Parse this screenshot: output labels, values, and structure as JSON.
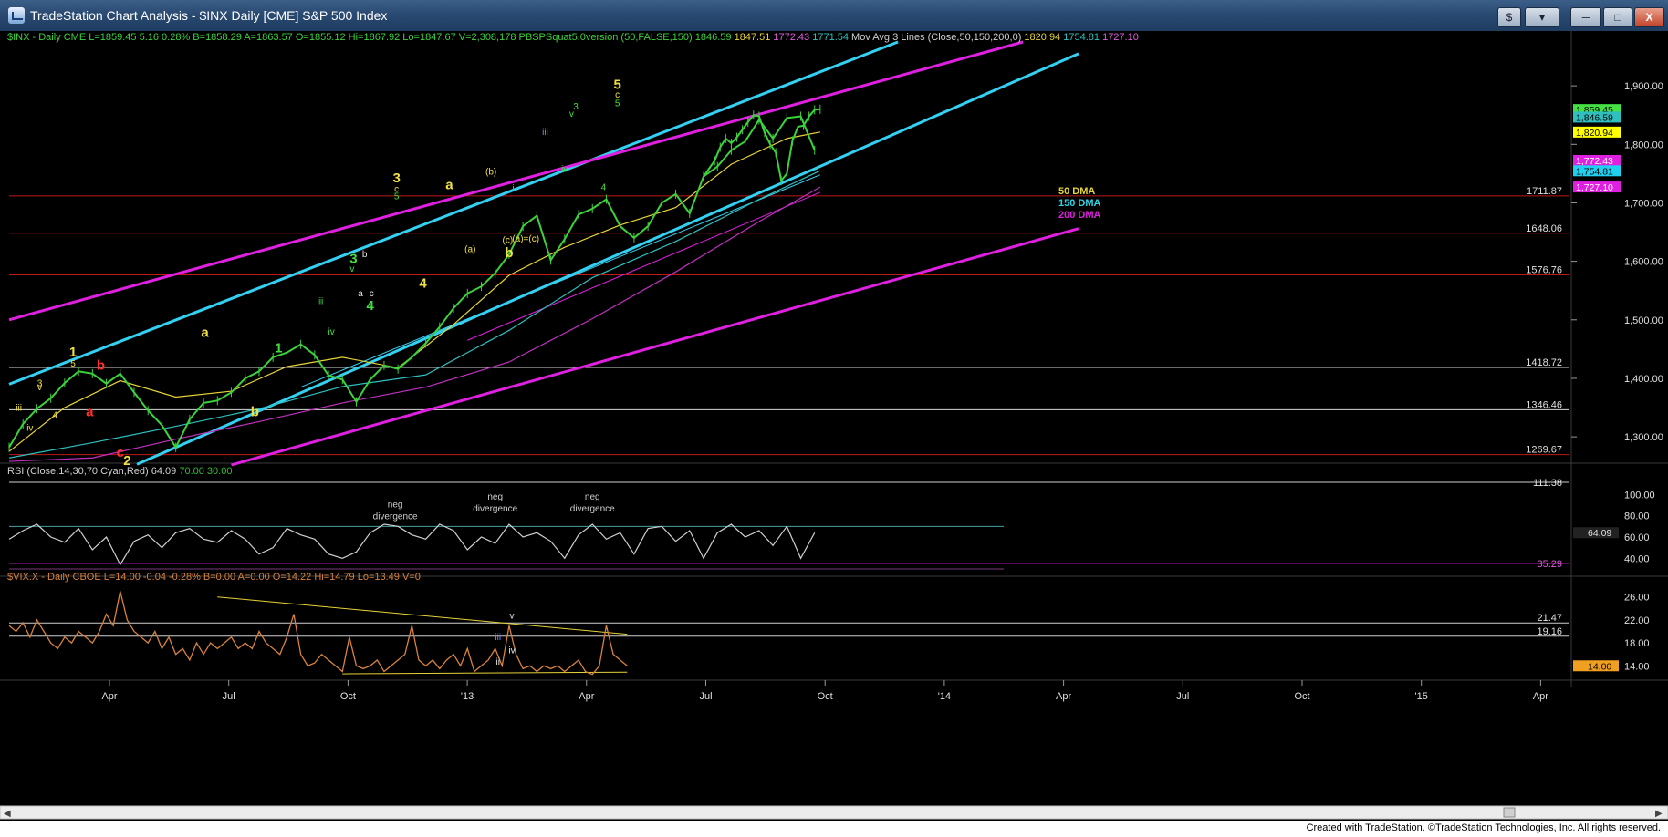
{
  "window": {
    "title": "TradeStation Chart Analysis - $INX Daily [CME] S&P 500 Index",
    "buttons": {
      "dollar": "$",
      "toggle": "",
      "minimize": "",
      "maximize": "",
      "close": "X"
    }
  },
  "footer": {
    "credit": "Created with TradeStation. ©TradeStation Technologies, Inc. All rights reserved."
  },
  "colors": {
    "background": "#000000",
    "price": "#3cd23c",
    "vix": "#d8823c",
    "rsi": "#cfcfcf",
    "channel_cyan": "#33d0f2",
    "channel_magenta": "#e020e0",
    "sma50": "#e6d238",
    "sma150": "#2fbfbf",
    "sma200": "#c030c0",
    "hline_red": "#c01818",
    "hline_white": "#d8d8d8"
  },
  "price_header": [
    {
      "t": "$INX - Daily  CME  L=1859.45  5.16  0.28%  B=1858.29  A=1863.57  O=1855.12  Hi=1867.92  Lo=1847.67  V=2,308,178  PBSPSquat5.0version (50,FALSE,150)",
      "c": "#3cd23c"
    },
    {
      "t": "1846.59",
      "c": "#3cd23c"
    },
    {
      "t": "1847.51",
      "c": "#e6d238"
    },
    {
      "t": "1772.43",
      "c": "#e05ce0"
    },
    {
      "t": "1771.54",
      "c": "#2fbfbf"
    },
    {
      "t": "Mov Avg 3 Lines (Close,50,150,200,0)",
      "c": "#d0d0d0"
    },
    {
      "t": "1820.94",
      "c": "#e6d238"
    },
    {
      "t": "1754.81",
      "c": "#2fbfbf"
    },
    {
      "t": "1727.10",
      "c": "#e05ce0"
    }
  ],
  "rsi_header": [
    {
      "t": "RSI (Close,14,30,70,Cyan,Red)",
      "c": "#d0d0d0"
    },
    {
      "t": "64.09",
      "c": "#d0d0d0"
    },
    {
      "t": "70.00",
      "c": "#2fbf2f"
    },
    {
      "t": "30.00",
      "c": "#2fbf2f"
    }
  ],
  "vix_header": [
    {
      "t": "$VIX.X - Daily  CBOE  L=14.00  -0.04  -0.28%  B=0.00  A=0.00  O=14.22  Hi=14.79  Lo=13.49  V=0",
      "c": "#d8823c"
    }
  ],
  "ma_legend": [
    {
      "t": "50 DMA",
      "c": "#e6d238"
    },
    {
      "t": "150 DMA",
      "c": "#2fd6e8"
    },
    {
      "t": "200 DMA",
      "c": "#e020e0"
    }
  ],
  "chart_data": [
    {
      "type": "line",
      "title": "$INX Daily [CME] S&P 500 Index",
      "x_labels": [
        "Apr",
        "Jul",
        "Oct",
        "'13",
        "Apr",
        "Jul",
        "Oct",
        "'14",
        "Apr",
        "Jul",
        "Oct",
        "'15",
        "Apr"
      ],
      "y_ticks": [
        1300,
        1400,
        1500,
        1600,
        1700,
        1800,
        1900
      ],
      "ylim": [
        1255,
        1975
      ],
      "grid": false,
      "series": [
        {
          "x": [
            0,
            10,
            20,
            30,
            40,
            50,
            60,
            70,
            80,
            90,
            100,
            110,
            120,
            130,
            140,
            150,
            160,
            170,
            180,
            190,
            200,
            210,
            220,
            230,
            240,
            250,
            260,
            270,
            280,
            290,
            300,
            310,
            320,
            330,
            340,
            350,
            360,
            370,
            380,
            390,
            400,
            410,
            420,
            430,
            440,
            450,
            460,
            470,
            480,
            490,
            500,
            510,
            520,
            530,
            540,
            550,
            560,
            570,
            580
          ],
          "values": [
            1282,
            1322,
            1348,
            1366,
            1392,
            1412,
            1408,
            1391,
            1408,
            1376,
            1345,
            1320,
            1282,
            1330,
            1358,
            1362,
            1376,
            1400,
            1412,
            1436,
            1444,
            1458,
            1440,
            1405,
            1398,
            1360,
            1398,
            1422,
            1416,
            1436,
            1460,
            1488,
            1520,
            1545,
            1557,
            1580,
            1612,
            1660,
            1678,
            1602,
            1638,
            1680,
            1690,
            1706,
            1660,
            1640,
            1660,
            1700,
            1715,
            1682,
            1745,
            1762,
            1790,
            1805,
            1842,
            1810,
            1845,
            1848,
            1790
          ]
        },
        {
          "x": [
            500,
            508,
            512,
            516,
            520,
            524,
            528,
            532,
            536,
            540,
            544,
            548,
            552,
            556,
            560,
            564,
            568,
            572,
            576,
            580,
            584
          ],
          "values": [
            1745,
            1772,
            1795,
            1810,
            1802,
            1812,
            1825,
            1838,
            1850,
            1848,
            1820,
            1800,
            1786,
            1738,
            1750,
            1806,
            1830,
            1832,
            1848,
            1859,
            1860
          ]
        }
      ],
      "moving_averages": {
        "sma50": {
          "x": [
            0,
            40,
            80,
            120,
            160,
            200,
            240,
            280,
            320,
            360,
            400,
            440,
            480,
            520,
            560,
            584
          ],
          "values": [
            1275,
            1350,
            1396,
            1368,
            1378,
            1420,
            1436,
            1418,
            1492,
            1576,
            1624,
            1662,
            1692,
            1766,
            1810,
            1821
          ]
        },
        "sma150": {
          "x": [
            0,
            60,
            120,
            180,
            240,
            300,
            360,
            420,
            480,
            540,
            584
          ],
          "values": [
            1264,
            1290,
            1318,
            1348,
            1386,
            1406,
            1482,
            1572,
            1634,
            1706,
            1755
          ]
        },
        "sma200": {
          "x": [
            0,
            60,
            120,
            180,
            240,
            300,
            360,
            420,
            480,
            540,
            584
          ],
          "values": [
            1258,
            1264,
            1296,
            1326,
            1358,
            1385,
            1428,
            1502,
            1582,
            1668,
            1727
          ]
        }
      },
      "horizontal_levels": [
        {
          "label": "1711.87",
          "value": 1711.87,
          "color": "red"
        },
        {
          "label": "1648.06",
          "value": 1648.06,
          "color": "red"
        },
        {
          "label": "1576.76",
          "value": 1576.76,
          "color": "red"
        },
        {
          "label": "1418.72",
          "value": 1418.72,
          "color": "white"
        },
        {
          "label": "1346.46",
          "value": 1346.46,
          "color": "white"
        },
        {
          "label": "1269.67",
          "value": 1269.67,
          "color": "red"
        }
      ],
      "price_tags": [
        {
          "label": "1,859.45",
          "value": 1859.45,
          "bg": "#44e044",
          "fg": "#000000"
        },
        {
          "label": "1,846.59",
          "value": 1846.59,
          "bg": "#2fbfbf",
          "fg": "#000000"
        },
        {
          "label": "1,820.94",
          "value": 1820.94,
          "bg": "#ffff00",
          "fg": "#000000"
        },
        {
          "label": "1,772.43",
          "value": 1772.43,
          "bg": "#e020e0",
          "fg": "#ffffff"
        },
        {
          "label": "1,754.81",
          "value": 1754.81,
          "bg": "#20d0f0",
          "fg": "#000000"
        },
        {
          "label": "1,727.10",
          "value": 1727.1,
          "bg": "#e020e0",
          "fg": "#ffffff"
        }
      ],
      "trend_channels": [
        {
          "name": "cyan-upper",
          "color": "cyan",
          "x1": 0,
          "y1": 1390,
          "x2": 640,
          "y2": 1975
        },
        {
          "name": "cyan-lower",
          "color": "cyan",
          "x1": 92,
          "y1": 1253,
          "x2": 770,
          "y2": 1955
        },
        {
          "name": "magenta-upper",
          "color": "magenta",
          "x1": 0,
          "y1": 1500,
          "x2": 730,
          "y2": 1975
        },
        {
          "name": "magenta-lower",
          "color": "magenta",
          "x1": 160,
          "y1": 1252,
          "x2": 770,
          "y2": 1656
        },
        {
          "name": "cyan-minor",
          "color": "cyan",
          "x1": 210,
          "y1": 1385,
          "x2": 584,
          "y2": 1748
        },
        {
          "name": "magenta-minor",
          "color": "magenta",
          "x1": 330,
          "y1": 1465,
          "x2": 584,
          "y2": 1718
        }
      ],
      "wave_labels": [
        {
          "t": "iii",
          "x": 7,
          "v": 1345,
          "c": "yellow"
        },
        {
          "t": "iv",
          "x": 15,
          "v": 1310,
          "c": "yellow"
        },
        {
          "t": "v",
          "x": 22,
          "v": 1380,
          "c": "yellow"
        },
        {
          "t": "3",
          "x": 22,
          "v": 1387,
          "c": "yellow"
        },
        {
          "t": "4",
          "x": 33,
          "v": 1332,
          "c": "yellow"
        },
        {
          "t": "1",
          "x": 46,
          "v": 1437,
          "c": "yellow",
          "big": true
        },
        {
          "t": "5",
          "x": 46,
          "v": 1420,
          "c": "yellow"
        },
        {
          "t": "b",
          "x": 66,
          "v": 1415,
          "c": "red",
          "big": true
        },
        {
          "t": "a",
          "x": 58,
          "v": 1335,
          "c": "red",
          "big": true
        },
        {
          "t": "c",
          "x": 80,
          "v": 1266,
          "c": "red",
          "big": true
        },
        {
          "t": "2",
          "x": 85,
          "v": 1252,
          "c": "yellow",
          "big": true
        },
        {
          "t": "a",
          "x": 141,
          "v": 1471,
          "c": "yellow",
          "big": true
        },
        {
          "t": "b",
          "x": 177,
          "v": 1335,
          "c": "yellow",
          "big": true
        },
        {
          "t": "1",
          "x": 194,
          "v": 1444,
          "c": "green",
          "big": true
        },
        {
          "t": "iii",
          "x": 224,
          "v": 1527,
          "c": "green"
        },
        {
          "t": "iv",
          "x": 232,
          "v": 1475,
          "c": "green"
        },
        {
          "t": "3",
          "x": 248,
          "v": 1597,
          "c": "green",
          "big": true
        },
        {
          "t": "v",
          "x": 247,
          "v": 1582,
          "c": "green"
        },
        {
          "t": "b",
          "x": 256,
          "v": 1607,
          "c": "white"
        },
        {
          "t": "a",
          "x": 253,
          "v": 1540,
          "c": "white"
        },
        {
          "t": "c",
          "x": 261,
          "v": 1540,
          "c": "white"
        },
        {
          "t": "4",
          "x": 260,
          "v": 1517,
          "c": "green",
          "big": true
        },
        {
          "t": "3",
          "x": 279,
          "v": 1735,
          "c": "yellow",
          "big": true
        },
        {
          "t": "c",
          "x": 279,
          "v": 1719,
          "c": "yellow"
        },
        {
          "t": "5",
          "x": 279,
          "v": 1706,
          "c": "green"
        },
        {
          "t": "4",
          "x": 298,
          "v": 1555,
          "c": "yellow",
          "big": true
        },
        {
          "t": "a",
          "x": 317,
          "v": 1723,
          "c": "yellow",
          "big": true
        },
        {
          "t": "(a)",
          "x": 332,
          "v": 1616,
          "c": "yellow"
        },
        {
          "t": "(b)",
          "x": 347,
          "v": 1748,
          "c": "yellow"
        },
        {
          "t": "(c)",
          "x": 359,
          "v": 1631,
          "c": "yellow"
        },
        {
          "t": "(a)=(c)",
          "x": 372,
          "v": 1634,
          "c": "yellow"
        },
        {
          "t": "b",
          "x": 360,
          "v": 1607,
          "c": "yellow",
          "big": true
        },
        {
          "t": "i",
          "x": 363,
          "v": 1720,
          "c": "green"
        },
        {
          "t": "iii",
          "x": 386,
          "v": 1816,
          "c": "blue"
        },
        {
          "t": "iv",
          "x": 400,
          "v": 1753,
          "c": "green"
        },
        {
          "t": "3",
          "x": 408,
          "v": 1860,
          "c": "green"
        },
        {
          "t": "v",
          "x": 405,
          "v": 1847,
          "c": "green"
        },
        {
          "t": "4",
          "x": 428,
          "v": 1722,
          "c": "green"
        },
        {
          "t": "5",
          "x": 438,
          "v": 1895,
          "c": "yellow",
          "big": true
        },
        {
          "t": "c",
          "x": 438,
          "v": 1880,
          "c": "yellow"
        },
        {
          "t": "5",
          "x": 438,
          "v": 1865,
          "c": "green"
        }
      ]
    },
    {
      "type": "line",
      "title": "RSI (Close,14,30,70,Cyan,Red)",
      "y_ticks": [
        40,
        60,
        80,
        100
      ],
      "ylim": [
        30,
        114
      ],
      "x": [
        0,
        10,
        20,
        30,
        40,
        50,
        60,
        70,
        80,
        90,
        100,
        110,
        120,
        130,
        140,
        150,
        160,
        170,
        180,
        190,
        200,
        210,
        220,
        230,
        240,
        250,
        260,
        270,
        280,
        290,
        300,
        310,
        320,
        330,
        340,
        350,
        360,
        370,
        380,
        390,
        400,
        410,
        420,
        430,
        440,
        450,
        460,
        470,
        480,
        490,
        500,
        510,
        520,
        530,
        540,
        550,
        560,
        570,
        580
      ],
      "values": [
        58,
        66,
        72,
        60,
        55,
        68,
        48,
        60,
        34,
        56,
        62,
        50,
        64,
        68,
        58,
        55,
        66,
        58,
        44,
        50,
        68,
        62,
        58,
        44,
        40,
        46,
        64,
        72,
        70,
        62,
        58,
        72,
        66,
        48,
        60,
        54,
        72,
        60,
        64,
        56,
        40,
        62,
        72,
        58,
        64,
        44,
        68,
        70,
        56,
        66,
        40,
        64,
        72,
        60,
        66,
        52,
        70,
        40,
        64
      ],
      "levels": [
        {
          "label": "111.38",
          "value": 111.38
        },
        {
          "label": "35.29",
          "value": 35.29,
          "color": "magenta"
        }
      ],
      "last_value": "64.09",
      "annotations": [
        {
          "lines": [
            "neg",
            "divergence"
          ],
          "x": 278,
          "v": 88
        },
        {
          "lines": [
            "neg",
            "divergence"
          ],
          "x": 350,
          "v": 95
        },
        {
          "lines": [
            "neg",
            "divergence"
          ],
          "x": 420,
          "v": 95
        }
      ]
    },
    {
      "type": "line",
      "title": "$VIX.X - Daily",
      "y_ticks": [
        14,
        18,
        22,
        26
      ],
      "ylim": [
        11.5,
        28.5
      ],
      "x": [
        0,
        5,
        10,
        15,
        20,
        25,
        30,
        35,
        40,
        45,
        50,
        55,
        60,
        65,
        70,
        75,
        80,
        85,
        90,
        95,
        100,
        105,
        110,
        115,
        120,
        125,
        130,
        135,
        140,
        145,
        150,
        155,
        160,
        165,
        170,
        175,
        180,
        185,
        190,
        195,
        200,
        205,
        210,
        215,
        220,
        225,
        230,
        235,
        240,
        245,
        250,
        255,
        260,
        265,
        270,
        275,
        280,
        285,
        290,
        295,
        300,
        305,
        310,
        315,
        320,
        325,
        330,
        335,
        340,
        345,
        350,
        355,
        360,
        365,
        370,
        375,
        380,
        385,
        390,
        395,
        400,
        405,
        410,
        415,
        420,
        425,
        430,
        435,
        440,
        445
      ],
      "values": [
        21,
        20,
        21.5,
        19,
        22,
        20,
        18,
        17,
        19,
        18,
        20,
        19,
        18,
        20,
        23,
        21,
        27,
        22,
        20,
        19,
        18,
        20,
        17,
        19,
        16,
        17,
        15,
        18,
        16,
        18,
        17,
        18,
        19,
        17,
        18,
        17,
        20,
        18,
        17,
        16,
        19,
        23,
        16,
        14,
        14.5,
        16,
        15,
        14,
        13,
        19,
        14,
        13.5,
        14,
        15,
        13,
        14,
        15,
        16,
        21,
        15,
        14,
        15,
        13.5,
        15,
        16,
        14,
        17,
        13,
        14,
        15,
        17,
        14,
        21,
        16,
        13.5,
        14,
        13,
        14,
        13.5,
        14,
        13,
        14,
        15,
        13,
        12.5,
        14,
        21,
        16,
        15,
        14
      ],
      "levels": [
        {
          "label": "21.47",
          "value": 21.47
        },
        {
          "label": "19.16",
          "value": 19.16
        }
      ],
      "last_tag": {
        "label": "14.00",
        "value": 14.0
      },
      "wave_labels": [
        {
          "t": "v",
          "x": 362,
          "v": 22.2,
          "c": "white"
        },
        {
          "t": "iii",
          "x": 352,
          "v": 18.5,
          "c": "blue"
        },
        {
          "t": "iv",
          "x": 362,
          "v": 16.2,
          "c": "white"
        },
        {
          "t": "ii",
          "x": 352,
          "v": 14.2,
          "c": "white"
        }
      ]
    }
  ]
}
